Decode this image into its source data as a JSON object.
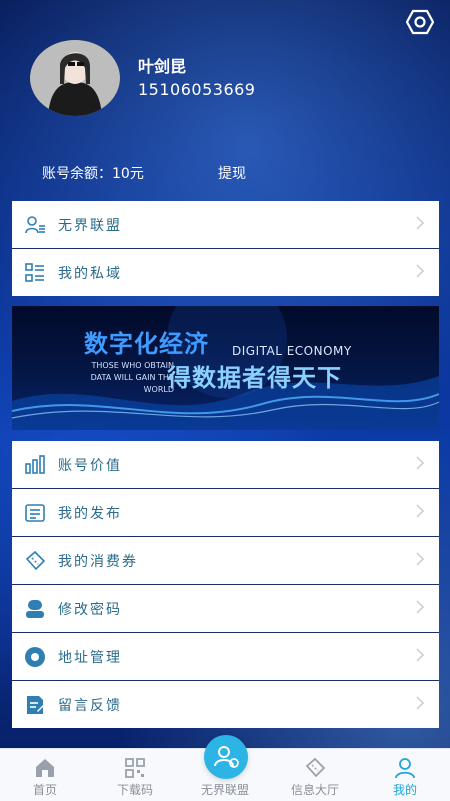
{
  "profile": {
    "name": "叶剑昆",
    "phone": "15106053669"
  },
  "account": {
    "balance_label": "账号余额：10元",
    "withdraw_label": "提现"
  },
  "menu_top": [
    {
      "label": "无界联盟",
      "icon": "user-list-icon"
    },
    {
      "label": "我的私域",
      "icon": "list-grid-icon"
    }
  ],
  "banner": {
    "title": "数字化经济",
    "subtitle": "DIGITAL ECONOMY",
    "slogan": "得数据者得天下",
    "small_text": "THOSE WHO OBTAIN DATA WILL GAIN THE WORLD"
  },
  "menu_main": [
    {
      "label": "账号价值",
      "icon": "bar-chart-icon"
    },
    {
      "label": "我的发布",
      "icon": "document-icon"
    },
    {
      "label": "我的消费券",
      "icon": "ticket-icon"
    },
    {
      "label": "修改密码",
      "icon": "user-lock-icon"
    },
    {
      "label": "地址管理",
      "icon": "location-icon"
    },
    {
      "label": "留言反馈",
      "icon": "feedback-icon"
    }
  ],
  "bottom_nav": [
    {
      "label": "首页",
      "icon": "home-icon"
    },
    {
      "label": "下载码",
      "icon": "qr-code-icon"
    },
    {
      "label": "无界联盟",
      "icon": "alliance-icon"
    },
    {
      "label": "信息大厅",
      "icon": "ticket-icon"
    },
    {
      "label": "我的",
      "icon": "user-icon"
    }
  ],
  "colors": {
    "accent": "#1fa5d9",
    "menu_text": "#2b6b8c",
    "icon": "#2f7fb5"
  }
}
